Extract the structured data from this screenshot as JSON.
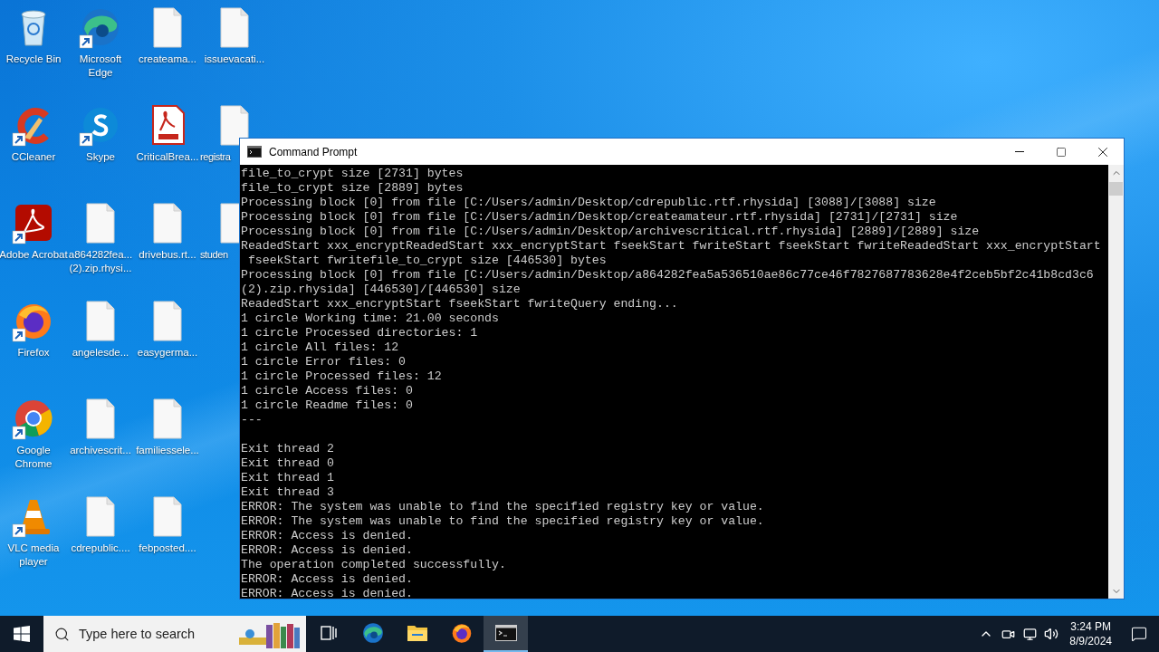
{
  "desktop": {
    "icons": [
      {
        "label": "Recycle Bin",
        "kind": "recycle",
        "shortcut": false
      },
      {
        "label": "CCleaner",
        "kind": "ccleaner",
        "shortcut": true
      },
      {
        "label": "Adobe Acrobat",
        "kind": "acrobat",
        "shortcut": true
      },
      {
        "label": "Firefox",
        "kind": "firefox",
        "shortcut": true
      },
      {
        "label": "Google Chrome",
        "kind": "chrome",
        "shortcut": true
      },
      {
        "label": "VLC media player",
        "kind": "vlc",
        "shortcut": true
      },
      {
        "label": "Microsoft Edge",
        "kind": "edge",
        "shortcut": true
      },
      {
        "label": "Skype",
        "kind": "skype",
        "shortcut": true
      },
      {
        "label": "a864282fea... (2).zip.rhysi...",
        "kind": "file",
        "shortcut": false
      },
      {
        "label": "angelesde...",
        "kind": "file",
        "shortcut": false
      },
      {
        "label": "archivescrit...",
        "kind": "file",
        "shortcut": false
      },
      {
        "label": "cdrepublic....",
        "kind": "file",
        "shortcut": false
      },
      {
        "label": "createama...",
        "kind": "file",
        "shortcut": false
      },
      {
        "label": "CriticalBrea...",
        "kind": "pdf",
        "shortcut": false
      },
      {
        "label": "drivebus.rt...",
        "kind": "file",
        "shortcut": false
      },
      {
        "label": "easygerma...",
        "kind": "file",
        "shortcut": false
      },
      {
        "label": "familiessele...",
        "kind": "file",
        "shortcut": false
      },
      {
        "label": "febposted....",
        "kind": "file",
        "shortcut": false
      },
      {
        "label": "issuevacati...",
        "kind": "file",
        "shortcut": false
      },
      {
        "label": "registra",
        "kind": "file",
        "shortcut": false
      },
      {
        "label": "studen",
        "kind": "file",
        "shortcut": false
      }
    ]
  },
  "window": {
    "title": "Command Prompt",
    "lines": [
      {
        "kind": "text",
        "text": "file_to_crypt size [2731] bytes"
      },
      {
        "kind": "text",
        "text": "file_to_crypt size [2889] bytes"
      },
      {
        "kind": "text",
        "text": "Processing block [0] from file [C:/Users/admin/Desktop/cdrepublic.rtf.rhysida] [3088]/[3088] size"
      },
      {
        "kind": "text",
        "text": "Processing block [0] from file [C:/Users/admin/Desktop/createamateur.rtf.rhysida] [2731]/[2731] size"
      },
      {
        "kind": "text",
        "text": "Processing block [0] from file [C:/Users/admin/Desktop/archivescritical.rtf.rhysida] [2889]/[2889] size"
      },
      {
        "kind": "text",
        "text": "ReadedStart xxx_encryptReadedStart xxx_encryptStart fseekStart fwriteStart fseekStart fwriteReadedStart xxx_encryptStart"
      },
      {
        "kind": "text",
        "text": " fseekStart fwritefile_to_crypt size [446530] bytes"
      },
      {
        "kind": "text",
        "text": "Processing block [0] from file [C:/Users/admin/Desktop/a864282fea5a536510ae86c77ce46f7827687783628e4f2ceb5bf2c41b8cd3c6"
      },
      {
        "kind": "text",
        "text": "(2).zip.rhysida] [446530]/[446530] size"
      },
      {
        "kind": "text",
        "text": "ReadedStart xxx_encryptStart fseekStart fwriteQuery ending..."
      },
      {
        "kind": "text",
        "text": "1 circle Working time: 21.00 seconds"
      },
      {
        "kind": "text",
        "text": "1 circle Processed directories: 1"
      },
      {
        "kind": "text",
        "text": "1 circle All files: 12"
      },
      {
        "kind": "text",
        "text": "1 circle Error files: 0"
      },
      {
        "kind": "text",
        "text": "1 circle Processed files: 12"
      },
      {
        "kind": "text",
        "text": "1 circle Access files: 0"
      },
      {
        "kind": "text",
        "text": "1 circle Readme files: 0"
      },
      {
        "kind": "text",
        "text": "---"
      },
      {
        "kind": "blank"
      },
      {
        "kind": "text",
        "text": "Exit thread 2"
      },
      {
        "kind": "text",
        "text": "Exit thread 0"
      },
      {
        "kind": "text",
        "text": "Exit thread 1"
      },
      {
        "kind": "text",
        "text": "Exit thread 3"
      },
      {
        "kind": "text",
        "text": "ERROR: The system was unable to find the specified registry key or value."
      },
      {
        "kind": "text",
        "text": "ERROR: The system was unable to find the specified registry key or value."
      },
      {
        "kind": "text",
        "text": "ERROR: Access is denied."
      },
      {
        "kind": "text",
        "text": "ERROR: Access is denied."
      },
      {
        "kind": "text",
        "text": "The operation completed successfully."
      },
      {
        "kind": "text",
        "text": "ERROR: Access is denied."
      },
      {
        "kind": "text",
        "text": "ERROR: Access is denied."
      }
    ]
  },
  "taskbar": {
    "search": {
      "placeholder": "Type here to search"
    },
    "apps": [
      {
        "kind": "taskview",
        "selected": false
      },
      {
        "kind": "edge",
        "selected": false
      },
      {
        "kind": "explorer",
        "selected": false
      },
      {
        "kind": "firefox",
        "selected": false
      },
      {
        "kind": "terminal",
        "selected": true
      }
    ],
    "clock": {
      "time": "3:24 PM",
      "date": "8/9/2024"
    }
  }
}
